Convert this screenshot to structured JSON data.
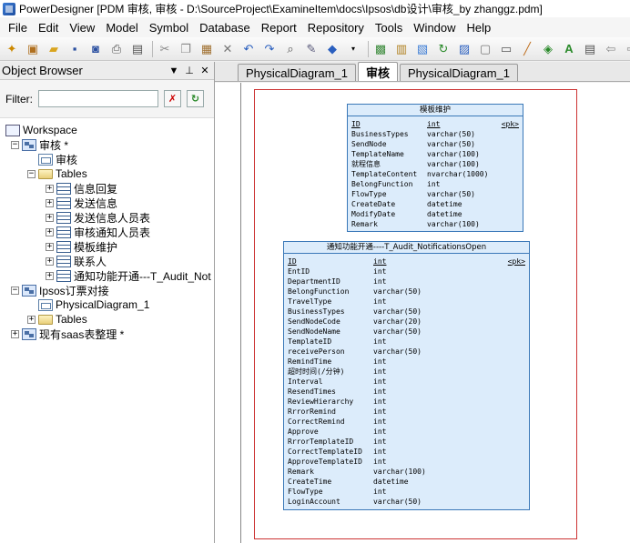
{
  "window": {
    "title": "PowerDesigner [PDM 审核, 审核 - D:\\SourceProject\\ExamineItem\\docs\\Ipsos\\db设计\\审核_by zhanggz.pdm]"
  },
  "menu": [
    {
      "label": "File",
      "key": "F"
    },
    {
      "label": "Edit",
      "key": "E"
    },
    {
      "label": "View",
      "key": "V"
    },
    {
      "label": "Model",
      "key": "M"
    },
    {
      "label": "Symbol",
      "key": "S"
    },
    {
      "label": "Database",
      "key": "D"
    },
    {
      "label": "Report",
      "key": "R"
    },
    {
      "label": "Repository",
      "key": "R"
    },
    {
      "label": "Tools",
      "key": "T"
    },
    {
      "label": "Window",
      "key": "W"
    },
    {
      "label": "Help",
      "key": "H"
    }
  ],
  "object_browser": {
    "title": "Object Browser",
    "filter_label": "Filter:",
    "filter_value": "",
    "tree": {
      "workspace": "Workspace",
      "model1": "审核 *",
      "model1_diagram": "审核",
      "tables_folder": "Tables",
      "tables": [
        "信息回复",
        "发送信息",
        "发送信息人员表",
        "审核通知人员表",
        "模板维护",
        "联系人",
        "通知功能开通---T_Audit_Not"
      ],
      "model2": "Ipsos订票对接",
      "model2_diagram": "PhysicalDiagram_1",
      "model2_tables": "Tables",
      "model3": "现有saas表整理 *"
    }
  },
  "tabs": [
    "PhysicalDiagram_1",
    "审核",
    "PhysicalDiagram_1"
  ],
  "entities": {
    "template": {
      "title": "模板维护",
      "columns": [
        {
          "name": "ID",
          "type": "int",
          "flag": "<pk>"
        },
        {
          "name": "BusinessTypes",
          "type": "varchar(50)",
          "flag": ""
        },
        {
          "name": "SendNode",
          "type": "varchar(50)",
          "flag": ""
        },
        {
          "name": "TemplateName",
          "type": "varchar(100)",
          "flag": ""
        },
        {
          "name": "就程信息",
          "type": "varchar(100)",
          "flag": ""
        },
        {
          "name": "TemplateContent",
          "type": "nvarchar(1000)",
          "flag": ""
        },
        {
          "name": "BelongFunction",
          "type": "int",
          "flag": ""
        },
        {
          "name": "FlowType",
          "type": "varchar(50)",
          "flag": ""
        },
        {
          "name": "CreateDate",
          "type": "datetime",
          "flag": ""
        },
        {
          "name": "ModifyDate",
          "type": "datetime",
          "flag": ""
        },
        {
          "name": "Remark",
          "type": "varchar(100)",
          "flag": ""
        }
      ]
    },
    "notify": {
      "title": "通知功能开通----T_Audit_NotificationsOpen",
      "columns": [
        {
          "name": "ID",
          "type": "int",
          "flag": "<pk>"
        },
        {
          "name": "EntID",
          "type": "int",
          "flag": ""
        },
        {
          "name": "DepartmentID",
          "type": "int",
          "flag": ""
        },
        {
          "name": "BelongFunction",
          "type": "varchar(50)",
          "flag": ""
        },
        {
          "name": "TravelType",
          "type": "int",
          "flag": ""
        },
        {
          "name": "BusinessTypes",
          "type": "varchar(50)",
          "flag": ""
        },
        {
          "name": "SendNodeCode",
          "type": "varchar(20)",
          "flag": ""
        },
        {
          "name": "SendNodeName",
          "type": "varchar(50)",
          "flag": ""
        },
        {
          "name": "TemplateID",
          "type": "int",
          "flag": ""
        },
        {
          "name": "receivePerson",
          "type": "varchar(50)",
          "flag": ""
        },
        {
          "name": "RemindTime",
          "type": "int",
          "flag": ""
        },
        {
          "name": "超时时间(/分钟)",
          "type": "int",
          "flag": ""
        },
        {
          "name": "Interval",
          "type": "int",
          "flag": ""
        },
        {
          "name": "ResendTimes",
          "type": "int",
          "flag": ""
        },
        {
          "name": "ReviewHierarchy",
          "type": "int",
          "flag": ""
        },
        {
          "name": "RrrorRemind",
          "type": "int",
          "flag": ""
        },
        {
          "name": "CorrectRemind",
          "type": "int",
          "flag": ""
        },
        {
          "name": "Approve",
          "type": "int",
          "flag": ""
        },
        {
          "name": "RrrorTemplateID",
          "type": "int",
          "flag": ""
        },
        {
          "name": "CorrectTemplateID",
          "type": "int",
          "flag": ""
        },
        {
          "name": "ApproveTemplateID",
          "type": "int",
          "flag": ""
        },
        {
          "name": "Remark",
          "type": "varchar(100)",
          "flag": ""
        },
        {
          "name": "CreateTime",
          "type": "datetime",
          "flag": ""
        },
        {
          "name": "FlowType",
          "type": "int",
          "flag": ""
        },
        {
          "name": "LoginAccount",
          "type": "varchar(50)",
          "flag": ""
        }
      ]
    }
  }
}
